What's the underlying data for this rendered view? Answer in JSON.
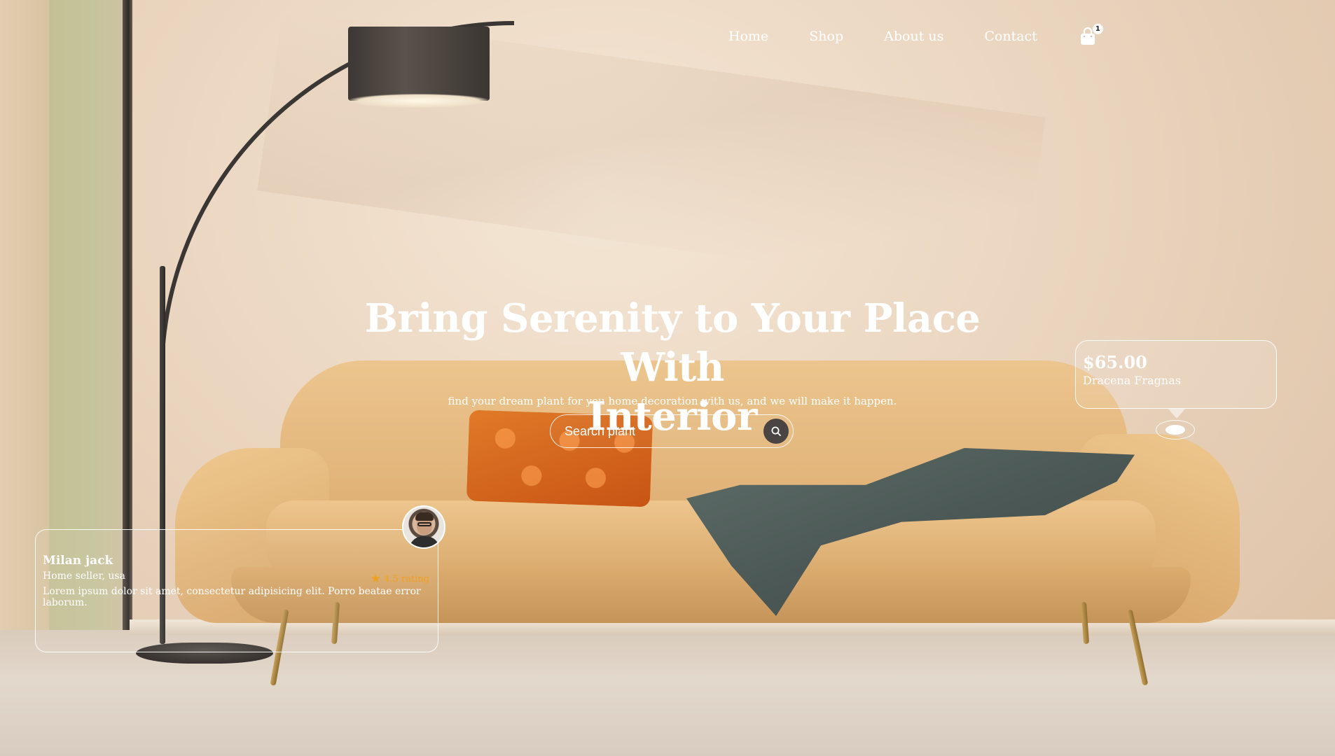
{
  "nav": {
    "items": [
      {
        "label": "Home"
      },
      {
        "label": "Shop"
      },
      {
        "label": "About us"
      },
      {
        "label": "Contact"
      }
    ],
    "cart_count": "1",
    "cart_icon": "shopping-bag-icon"
  },
  "hero": {
    "title_line1": "Bring Serenity to Your Place With",
    "title_line2": "Interior",
    "subtitle": "find your dream plant for you home decoration with us, and we will make it happen."
  },
  "search": {
    "placeholder": "Search plant",
    "icon": "search-icon"
  },
  "product": {
    "price": "$65.00",
    "name": "Dracena Fragnas"
  },
  "review": {
    "name": "Milan jack",
    "role": "Home seller, usa",
    "text": "Lorem ipsum dolor sit amet, consectetur adipisicing elit. Porro beatae error laborum.",
    "rating_text": "4.5 rating",
    "rating_icon": "star-icon"
  },
  "colors": {
    "accent_star": "#f0a020",
    "search_button": "#4a4542",
    "text": "#ffffff"
  }
}
